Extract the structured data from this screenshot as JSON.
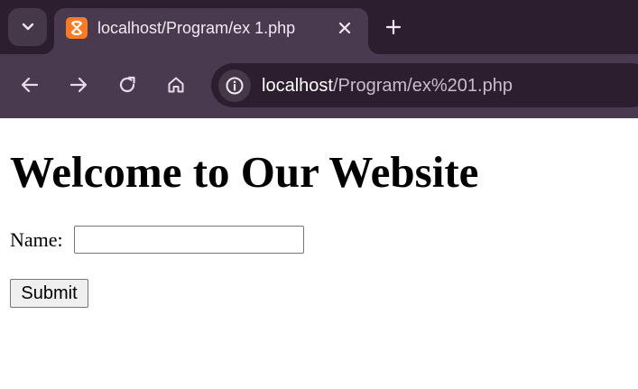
{
  "browser": {
    "tab": {
      "title": "localhost/Program/ex 1.php",
      "favicon": "xampp-icon"
    },
    "toolbar": {
      "url_host": "localhost",
      "url_path": "/Program/ex%201.php"
    },
    "icons": {
      "tab_search": "chevron-down-icon",
      "close_tab": "close-icon",
      "new_tab": "plus-icon",
      "back": "arrow-left-icon",
      "forward": "arrow-right-icon",
      "reload": "reload-icon",
      "home": "home-icon",
      "site_info": "info-icon"
    },
    "colors": {
      "tabstrip": "#2d1e2f",
      "toolbar": "#4a3a4f",
      "favicon": "#fb7a24"
    }
  },
  "page": {
    "heading": "Welcome to Our Website",
    "form": {
      "name_label": "Name:",
      "name_value": "",
      "submit_label": "Submit"
    }
  }
}
